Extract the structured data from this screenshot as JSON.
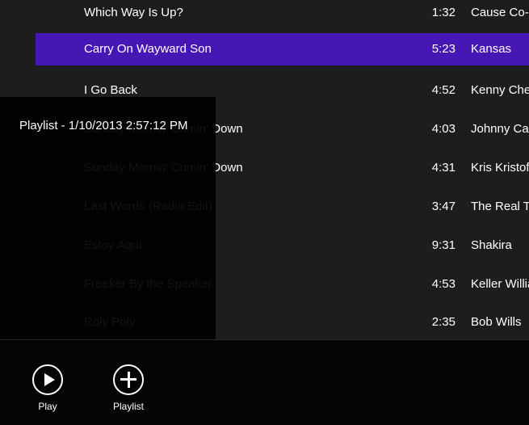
{
  "songs": [
    {
      "title": "Which Way Is Up?",
      "duration": "1:32",
      "artist": "Cause Co-Motion!"
    },
    {
      "title": "Carry On Wayward Son",
      "duration": "5:23",
      "artist": "Kansas",
      "selected": true
    },
    {
      "title": "I Go Back",
      "duration": "4:52",
      "artist": "Kenny Chesney"
    },
    {
      "title": "Sunday Mornin' Comin' Down",
      "duration": "4:03",
      "artist": "Johnny Cash"
    },
    {
      "title": "Sunday Mornin' Comin' Down",
      "duration": "4:31",
      "artist": "Kris Kristofferson"
    },
    {
      "title": "Last Words (Radio Edit)",
      "duration": "3:47",
      "artist": "The Real Tuesday Weld"
    },
    {
      "title": "Estoy Aquí",
      "duration": "9:31",
      "artist": "Shakira"
    },
    {
      "title": "Freeker By the Speaker",
      "duration": "4:53",
      "artist": "Keller Williams"
    },
    {
      "title": "Roly Poly",
      "duration": "2:35",
      "artist": "Bob Wills"
    }
  ],
  "flyout": {
    "title": "Playlist - 1/10/2013 2:57:12 PM"
  },
  "appbar": {
    "play_label": "Play",
    "playlist_label": "Playlist"
  },
  "colors": {
    "accent": "#4617b4",
    "background": "#1d1d1d",
    "appbar": "#040404"
  }
}
